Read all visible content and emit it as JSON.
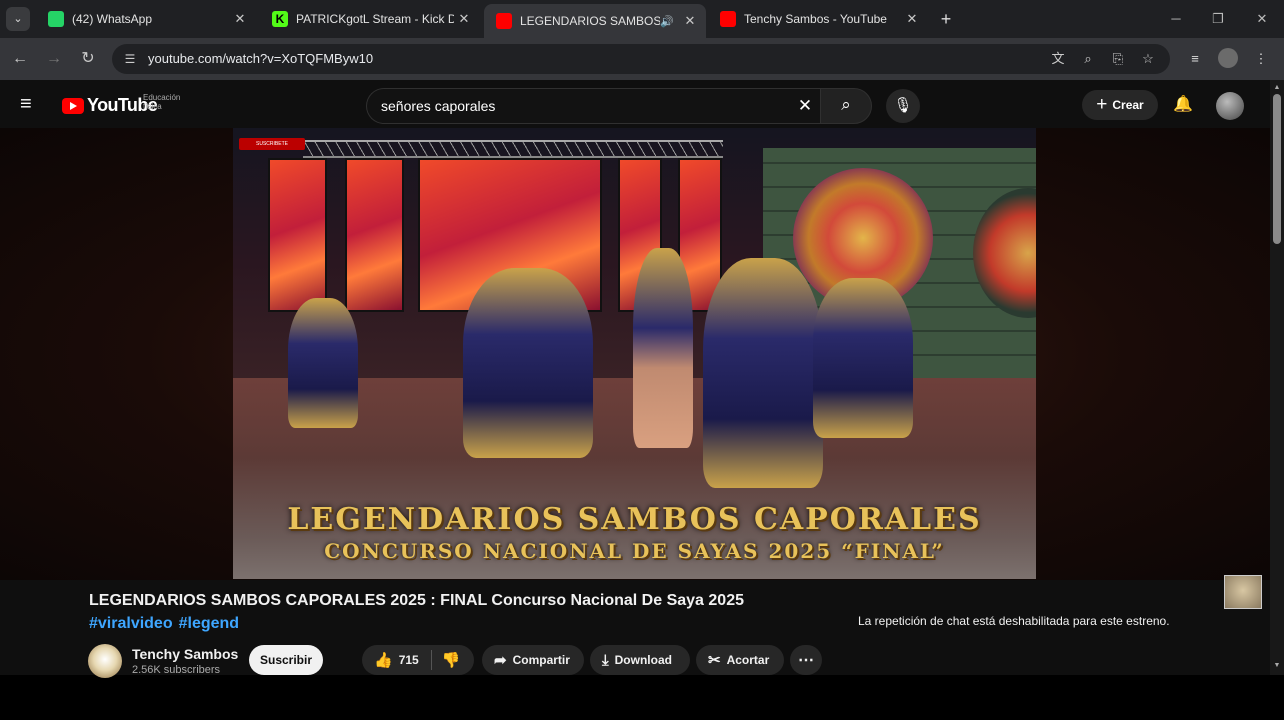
{
  "browser": {
    "tabs": [
      {
        "title": "(42) WhatsApp",
        "favicon": "whatsapp-icon"
      },
      {
        "title": "PATRICKgotL Stream - Kick Dashboard",
        "favicon": "kick-icon"
      },
      {
        "title": "LEGENDARIOS SAMBOS CAPORALES",
        "favicon": "youtube-icon",
        "active": true,
        "audio": true
      },
      {
        "title": "Tenchy Sambos - YouTube",
        "favicon": "youtube-icon"
      }
    ],
    "tab_close": "✕",
    "new_tab": "+",
    "address": "youtube.com/watch?v=XoTQFMByw10",
    "window_controls": {
      "minimize": "─",
      "restore": "❐",
      "close": "✕"
    }
  },
  "youtube": {
    "logo_text": "YouTube",
    "logo_sub": "Educación física",
    "search_query": "señores caporales",
    "create_label": "Crear",
    "video": {
      "overlay_subscribe": "SUSCRIBETE",
      "caption_line1": "LEGENDARIOS SAMBOS CAPORALES",
      "caption_line2": "CONCURSO NACIONAL DE SAYAS 2025 “FINAL”"
    },
    "title": "LEGENDARIOS SAMBOS CAPORALES 2025 : FINAL Concurso Nacional De Saya 2025",
    "hashtags": [
      "#viralvideo",
      "#legend"
    ],
    "channel": {
      "name": "Tenchy Sambos",
      "subscribers": "2.56K subscribers"
    },
    "subscribe_label": "Suscribir",
    "likes": "715",
    "share_label": "Compartir",
    "download_label": "Download",
    "clip_label": "Acortar",
    "chat_note": "La repetición de chat está deshabilitada para este estreno."
  },
  "colors": {
    "accent_red": "#ff0000",
    "link_blue": "#3ea6ff",
    "caption_gold": "#e8c25a"
  }
}
